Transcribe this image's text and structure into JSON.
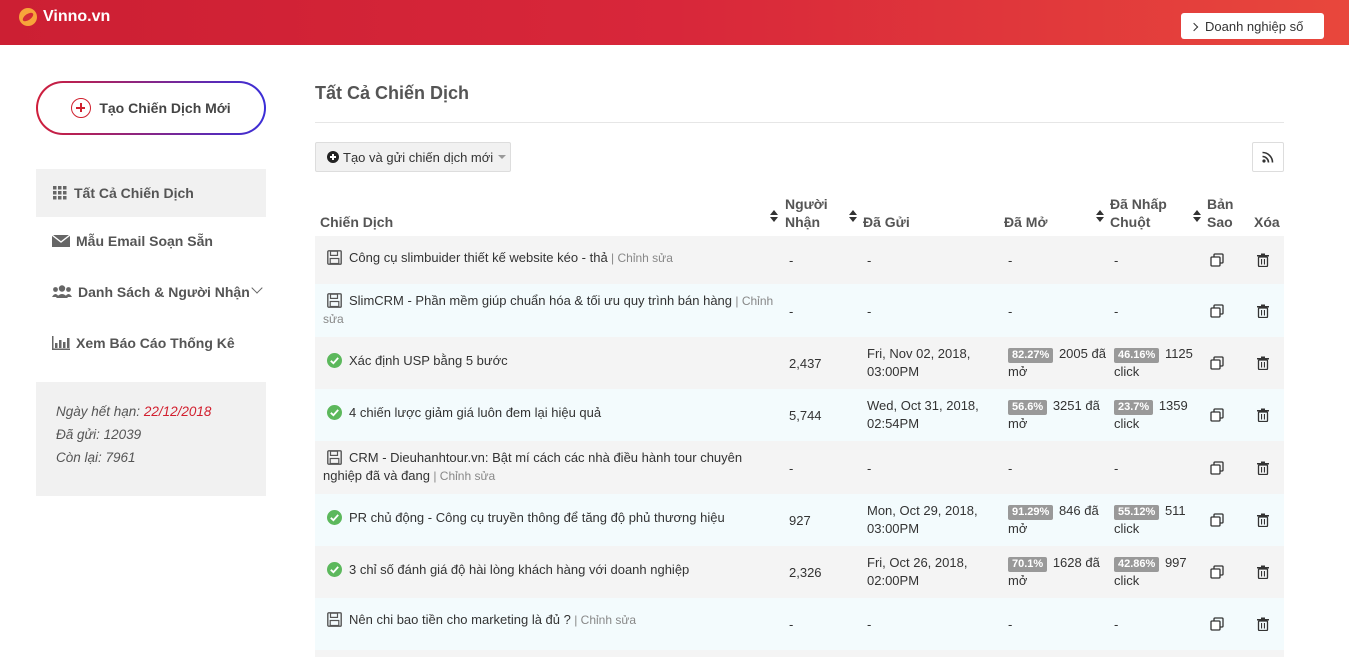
{
  "header": {
    "brand": "Vinno.vn",
    "business_button": "Doanh nghiệp số"
  },
  "sidebar": {
    "new_campaign_label": "Tạo Chiến Dịch Mới",
    "items": [
      {
        "label": "Tất Cả Chiến Dịch",
        "icon": "grid-icon",
        "active": true
      },
      {
        "label": "Mẫu Email Soạn Sẵn",
        "icon": "envelope-icon"
      },
      {
        "label": "Danh Sách & Người Nhận",
        "icon": "users-icon",
        "has_submenu": true
      },
      {
        "label": "Xem Báo Cáo Thống Kê",
        "icon": "chart-icon"
      }
    ],
    "info": {
      "expiry_label": "Ngày hết hạn: ",
      "expiry_value": "22/12/2018",
      "sent": "Đã gửi: 12039",
      "remaining": "Còn lại: 7961"
    }
  },
  "main": {
    "title": "Tất Cả Chiến Dịch",
    "create_send_label": "Tạo và gửi chiến dịch mới",
    "columns": {
      "name": "Chiến Dịch",
      "recipients_1": "Người",
      "recipients_2": "Nhận",
      "sent": "Đã Gửi",
      "opened": "Đã Mở",
      "clicked_1": "Đã Nhấp",
      "clicked_2": "Chuột",
      "copy_1": "Bản",
      "copy_2": "Sao",
      "delete": "Xóa"
    },
    "edit_label": "Chỉnh sửa",
    "rows": [
      {
        "status": "draft",
        "name": "Công cụ slimbuider thiết kế website kéo - thả",
        "recipients": "-",
        "sent": "-",
        "open_pct": "",
        "open_text": "-",
        "click_pct": "",
        "click_text": "-"
      },
      {
        "status": "draft",
        "name": "SlimCRM - Phần mềm giúp chuẩn hóa & tối ưu quy trình bán hàng",
        "recipients": "-",
        "sent": "-",
        "open_pct": "",
        "open_text": "-",
        "click_pct": "",
        "click_text": "-"
      },
      {
        "status": "sent",
        "name": "Xác định USP bằng 5 bước",
        "recipients": "2,437",
        "sent": "Fri, Nov 02, 2018, 03:00PM",
        "open_pct": "82.27%",
        "open_text": "2005 đã mở",
        "click_pct": "46.16%",
        "click_text": "1125 click"
      },
      {
        "status": "sent",
        "name": "4 chiến lược giảm giá luôn đem lại hiệu quả",
        "recipients": "5,744",
        "sent": "Wed, Oct 31, 2018, 02:54PM",
        "open_pct": "56.6%",
        "open_text": "3251 đã mở",
        "click_pct": "23.7%",
        "click_text": "1359 click"
      },
      {
        "status": "draft",
        "name": "CRM - Dieuhanhtour.vn: Bật mí cách các nhà điều hành tour chuyên nghiệp đã và đang",
        "recipients": "-",
        "sent": "-",
        "open_pct": "",
        "open_text": "-",
        "click_pct": "",
        "click_text": "-"
      },
      {
        "status": "sent",
        "name": "PR chủ động - Công cụ truyền thông để tăng độ phủ thương hiệu",
        "recipients": "927",
        "sent": "Mon, Oct 29, 2018, 03:00PM",
        "open_pct": "91.29%",
        "open_text": "846 đã mở",
        "click_pct": "55.12%",
        "click_text": "511 click"
      },
      {
        "status": "sent",
        "name": "3 chỉ số đánh giá độ hài lòng khách hàng với doanh nghiệp",
        "recipients": "2,326",
        "sent": "Fri, Oct 26, 2018, 02:00PM",
        "open_pct": "70.1%",
        "open_text": "1628 đã mở",
        "click_pct": "42.86%",
        "click_text": "997 click"
      },
      {
        "status": "draft",
        "name": "Nên chi bao tiền cho marketing là đủ ?",
        "recipients": "-",
        "sent": "-",
        "open_pct": "",
        "open_text": "-",
        "click_pct": "",
        "click_text": "-"
      }
    ]
  },
  "colors": {
    "header_start": "#cc1f33",
    "header_end": "#e8473c",
    "success": "#5cb85c",
    "badge": "#999999",
    "expiry": "#d21f2e"
  }
}
